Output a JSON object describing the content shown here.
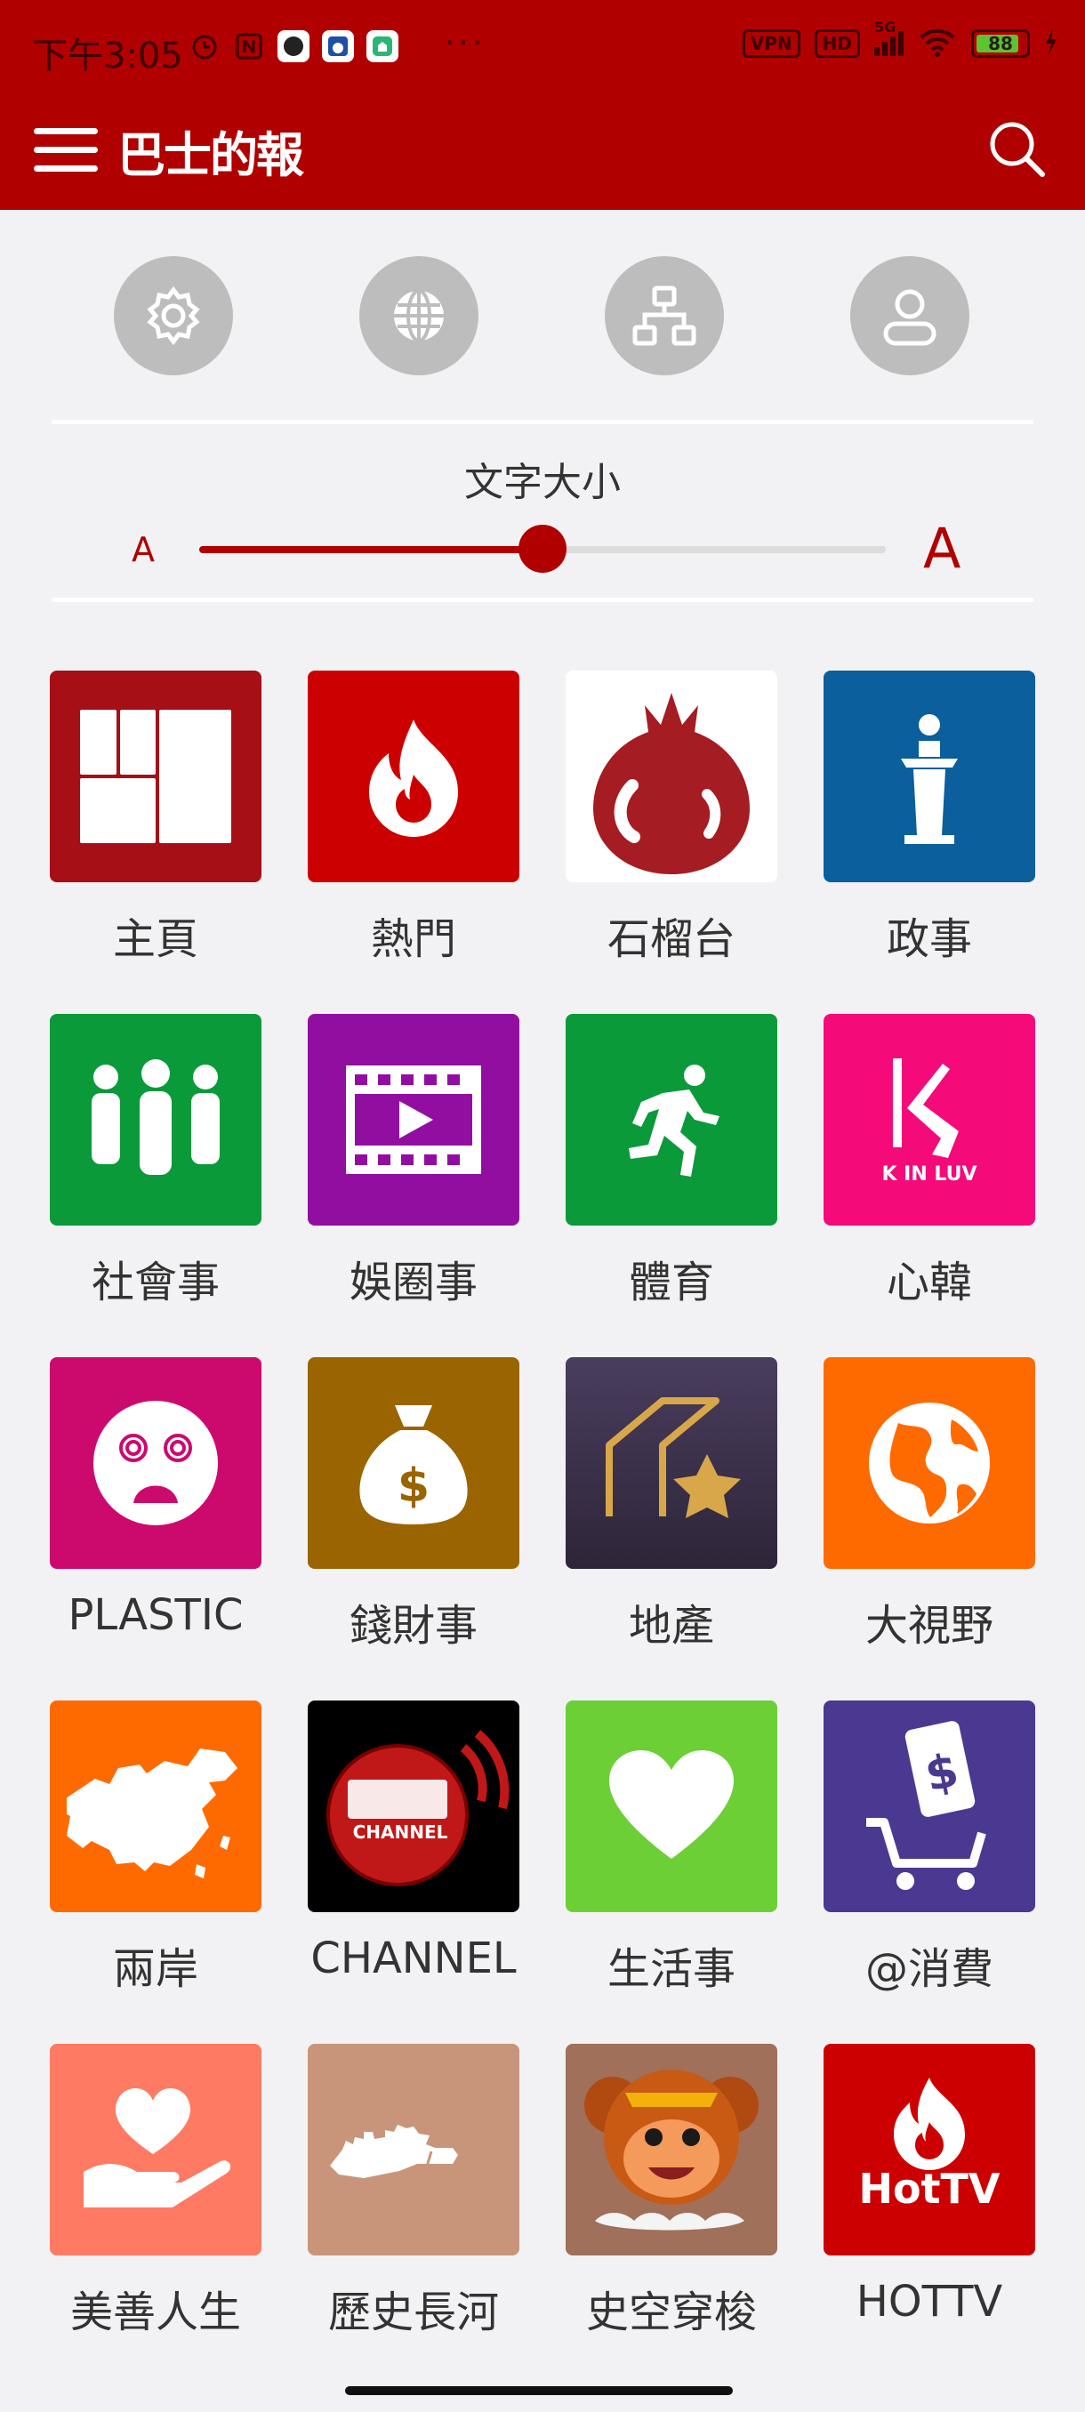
{
  "status_bar": {
    "time": "下午3:05",
    "dots": "···",
    "vpn": "VPN",
    "hd": "HD",
    "signal": "5G",
    "battery": "88"
  },
  "app_bar": {
    "logo_text": "巴士的報"
  },
  "font_size": {
    "title": "文字大小",
    "small_label": "A",
    "large_label": "A",
    "value_fraction": 0.5
  },
  "categories": [
    {
      "label": "主頁"
    },
    {
      "label": "熱門"
    },
    {
      "label": "石榴台"
    },
    {
      "label": "政事"
    },
    {
      "label": "社會事"
    },
    {
      "label": "娛圈事"
    },
    {
      "label": "體育"
    },
    {
      "label": "心韓",
      "icon_text": "K IN LUV"
    },
    {
      "label": "PLASTIC"
    },
    {
      "label": "錢財事"
    },
    {
      "label": "地產"
    },
    {
      "label": "大視野"
    },
    {
      "label": "兩岸"
    },
    {
      "label": "CHANNEL",
      "icon_text": "CHANNEL"
    },
    {
      "label": "生活事"
    },
    {
      "label": "@消費"
    },
    {
      "label": "美善人生"
    },
    {
      "label": "歷史長河"
    },
    {
      "label": "史空穿梭"
    },
    {
      "label": "HOTTV",
      "icon_text": "HotTV"
    }
  ],
  "colors": {
    "brand": "#b00000",
    "background": "#f2f2f4"
  }
}
